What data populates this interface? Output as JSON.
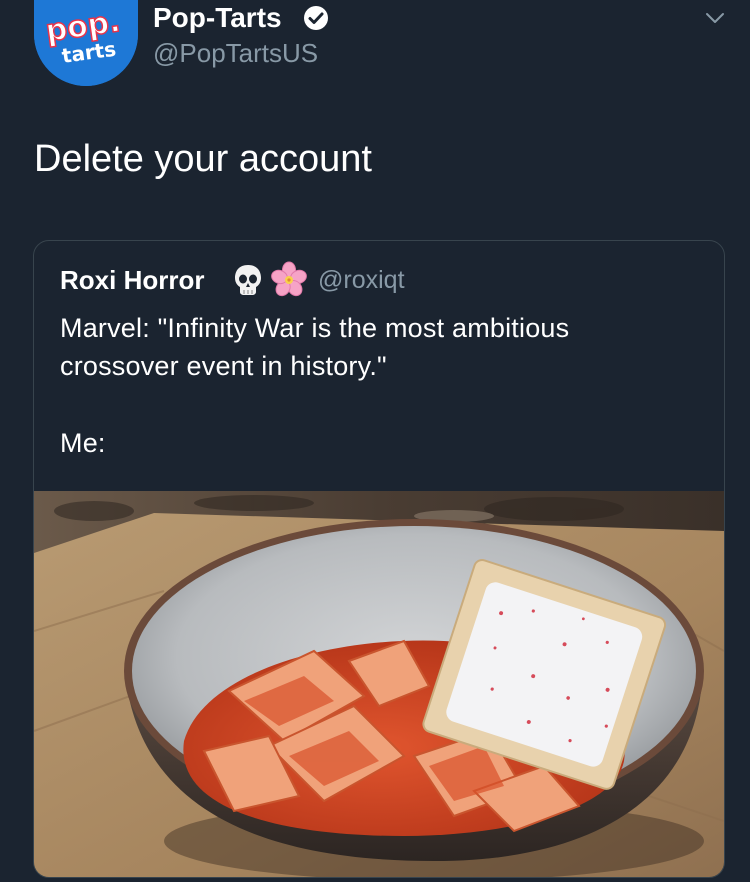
{
  "tweet": {
    "display_name": "Pop-Tarts",
    "handle": "@PopTartsUS",
    "text": "Delete your account",
    "avatar_logo": {
      "line1": "pop.",
      "line2": "tarts"
    }
  },
  "quoted_tweet": {
    "display_name": "Roxi Horror",
    "emojis": [
      "skull-emoji",
      "cherry-blossom-emoji"
    ],
    "handle": "@roxiqt",
    "text_lines": [
      "Marvel: \"Infinity War is the most ambitious",
      "crossover event in history.\"",
      "Me:"
    ]
  },
  "icons": {
    "verified": "verified-badge-icon",
    "menu": "chevron-down-icon"
  },
  "colors": {
    "background": "#1b2430",
    "secondary_text": "#8899a6",
    "brand_blue": "#1e78d6",
    "card_border": "#38444d"
  }
}
